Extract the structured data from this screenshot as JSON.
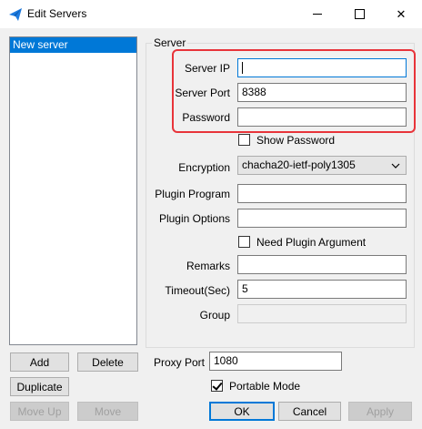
{
  "window": {
    "title": "Edit Servers",
    "minimize": "",
    "maximize": "",
    "close": "✕"
  },
  "server_list": {
    "items": [
      {
        "label": "New server",
        "selected": true
      }
    ]
  },
  "list_buttons": {
    "add": "Add",
    "delete": "Delete",
    "duplicate": "Duplicate",
    "move_up": "Move Up",
    "move_down": "Move"
  },
  "server": {
    "group_title": "Server",
    "ip_label": "Server IP",
    "ip_value": "",
    "port_label": "Server Port",
    "port_value": "8388",
    "password_label": "Password",
    "password_value": "",
    "show_password_label": "Show Password",
    "show_password_checked": false,
    "encryption_label": "Encryption",
    "encryption_value": "chacha20-ietf-poly1305",
    "plugin_program_label": "Plugin Program",
    "plugin_program_value": "",
    "plugin_options_label": "Plugin Options",
    "plugin_options_value": "",
    "need_plugin_arg_label": "Need Plugin Argument",
    "need_plugin_arg_checked": false,
    "remarks_label": "Remarks",
    "remarks_value": "",
    "timeout_label": "Timeout(Sec)",
    "timeout_value": "5",
    "group_label": "Group",
    "group_value": ""
  },
  "proxy": {
    "label": "Proxy Port",
    "value": "1080"
  },
  "portable_mode": {
    "label": "Portable Mode",
    "checked": true
  },
  "dialog_buttons": {
    "ok": "OK",
    "cancel": "Cancel",
    "apply": "Apply"
  },
  "colors": {
    "accent": "#0078d7",
    "highlight": "#e8343a"
  }
}
